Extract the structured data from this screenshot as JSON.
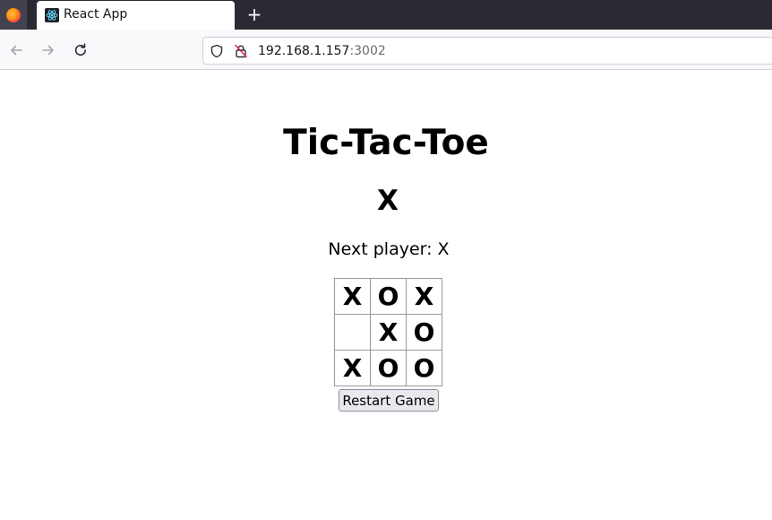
{
  "browser": {
    "tab_title": "React App",
    "tab_close": "×",
    "new_tab": "+",
    "url_host": "192.168.1.157",
    "url_port": ":3002"
  },
  "game": {
    "title": "Tic-Tac-Toe",
    "winner": "X",
    "status": "Next player: X",
    "board": [
      [
        "X",
        "O",
        "X"
      ],
      [
        "",
        "X",
        "O"
      ],
      [
        "X",
        "O",
        "O"
      ]
    ],
    "restart_label": "Restart Game"
  },
  "colors": {
    "tab_strip": "#2b2a33",
    "nav_bar": "#f9f9fb",
    "page_bg": "#ffffff",
    "square_border": "#999999",
    "button_bg": "#e9e9ed"
  }
}
